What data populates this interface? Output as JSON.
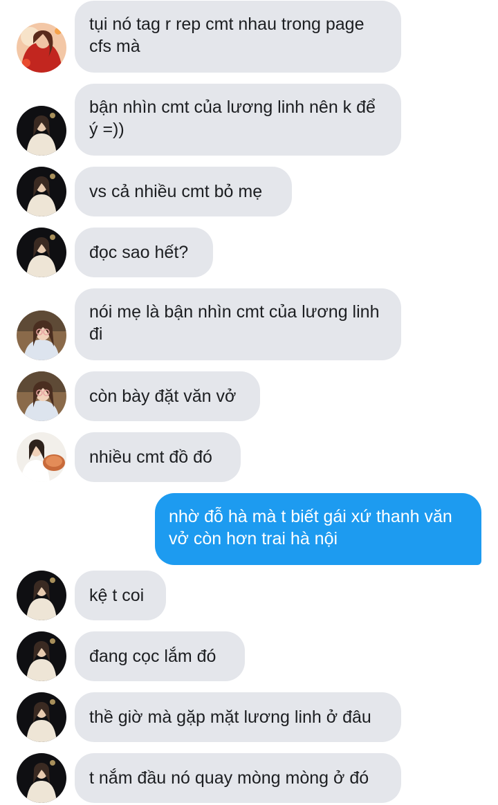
{
  "conversation": {
    "messages": [
      {
        "sender": "other",
        "avatar": "avatar-red-dress",
        "text": "tụi nó tag r rep cmt nhau trong page cfs mà"
      },
      {
        "sender": "other",
        "avatar": "avatar-dark-sweater",
        "text": "bận nhìn cmt của lương linh nên k để ý =))"
      },
      {
        "sender": "other",
        "avatar": "avatar-dark-sweater",
        "text": "vs cả nhiều cmt bỏ mẹ"
      },
      {
        "sender": "other",
        "avatar": "avatar-dark-sweater",
        "text": "đọc sao hết?"
      },
      {
        "sender": "other",
        "avatar": "avatar-glasses",
        "text": "nói mẹ là bận nhìn cmt của lương linh đi"
      },
      {
        "sender": "other",
        "avatar": "avatar-glasses",
        "text": "còn bày đặt văn vở"
      },
      {
        "sender": "other",
        "avatar": "avatar-food",
        "text": "nhiều cmt đồ đó"
      },
      {
        "sender": "self",
        "avatar": null,
        "text": "nhờ đỗ hà mà t biết gái xứ thanh văn vở còn hơn trai hà nội"
      },
      {
        "sender": "other",
        "avatar": "avatar-dark-sweater",
        "text": "kệ t coi"
      },
      {
        "sender": "other",
        "avatar": "avatar-dark-sweater",
        "text": "đang cọc lắm đó"
      },
      {
        "sender": "other",
        "avatar": "avatar-dark-sweater",
        "text": "thề giờ mà gặp mặt lương linh ở đâu"
      },
      {
        "sender": "other",
        "avatar": "avatar-dark-sweater",
        "text": "t nắm đầu nó quay mòng mòng ở đó"
      }
    ]
  },
  "colors": {
    "incoming_bubble": "#e4e6eb",
    "outgoing_bubble": "#1d9bf0",
    "incoming_text": "#1c1e21",
    "outgoing_text": "#ffffff"
  }
}
